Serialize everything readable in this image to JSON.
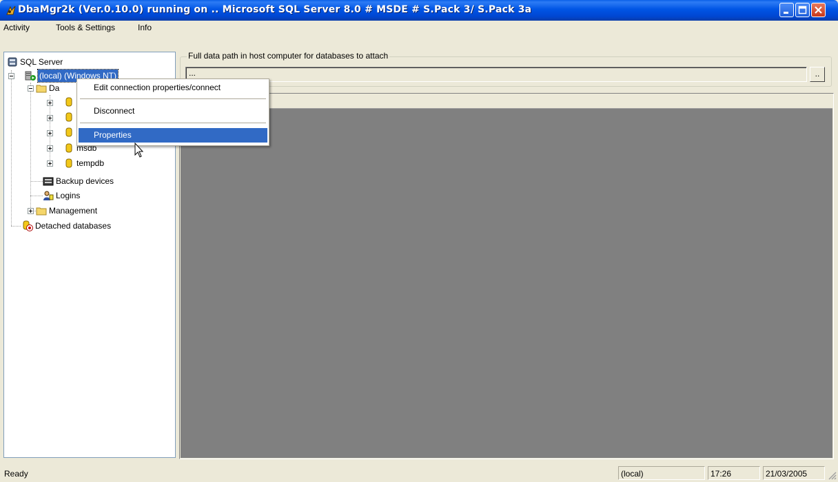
{
  "window": {
    "title": "DbaMgr2k (Ver.0.10.0) running on .. Microsoft SQL Server 8.0 # MSDE # S.Pack 3/ S.Pack 3a"
  },
  "menu": [
    "Activity",
    "Tools & Settings",
    "Info"
  ],
  "tree": {
    "root": "SQL Server",
    "server": "(local) (Windows NT)",
    "databases_folder": "Da",
    "databases": [
      "msdb",
      "tempdb"
    ],
    "backup_devices": "Backup devices",
    "logins": "Logins",
    "management": "Management",
    "detached": "Detached databases"
  },
  "data_path": {
    "group_title": "Full data path in host computer for databases to attach",
    "value": "...",
    "browse_label": ".."
  },
  "context_menu": {
    "items": [
      "Edit connection properties/connect",
      "Disconnect",
      "Properties"
    ],
    "highlighted": "Properties"
  },
  "status": {
    "text": "Ready",
    "server": "(local)",
    "time": "17:26",
    "date": "21/03/2005"
  },
  "colors": {
    "titlebar": "#0055E5",
    "workspace": "#808080",
    "selection": "#316AC5"
  }
}
